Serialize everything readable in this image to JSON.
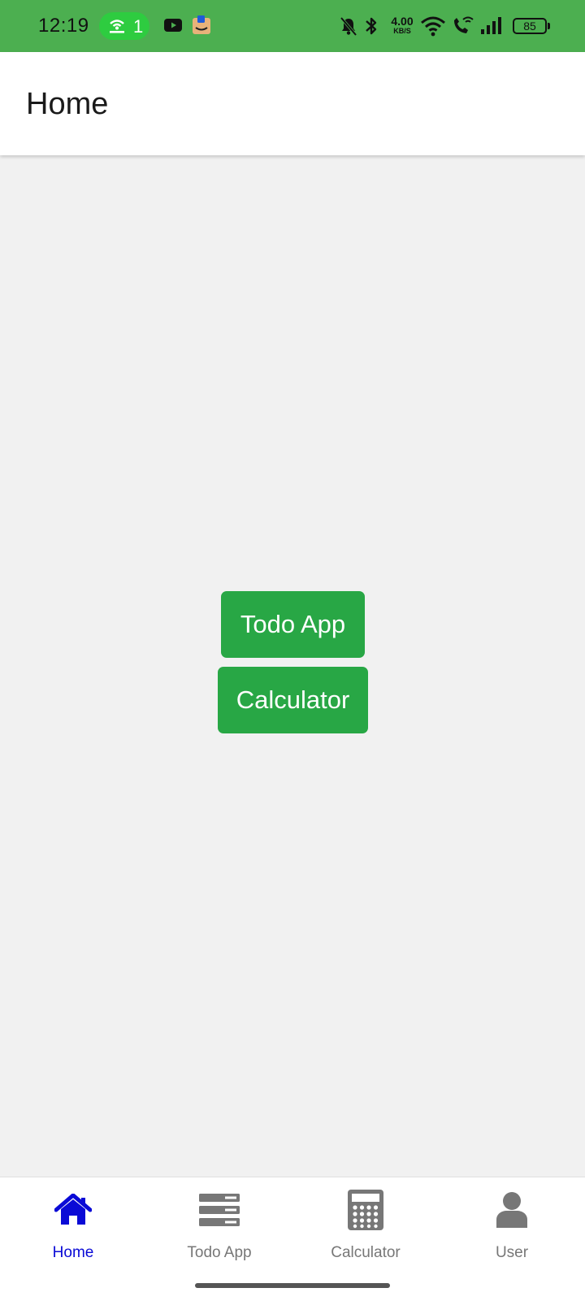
{
  "status_bar": {
    "time": "12:19",
    "hotspot_count": "1",
    "net_speed_value": "4.00",
    "net_speed_unit": "KB/S",
    "battery": "85",
    "icons": [
      "hotspot-icon",
      "youtube-icon",
      "amazon-icon",
      "mute-bell-icon",
      "bluetooth-icon",
      "wifi-icon",
      "wifi-calling-icon",
      "signal-icon",
      "battery-icon"
    ]
  },
  "app_bar": {
    "title": "Home"
  },
  "main": {
    "buttons": [
      {
        "label": "Todo App"
      },
      {
        "label": "Calculator"
      }
    ]
  },
  "bottom_nav": {
    "items": [
      {
        "label": "Home",
        "icon": "home-icon",
        "active": true
      },
      {
        "label": "Todo App",
        "icon": "list-icon",
        "active": false
      },
      {
        "label": "Calculator",
        "icon": "calculator-icon",
        "active": false
      },
      {
        "label": "User",
        "icon": "user-icon",
        "active": false
      }
    ]
  },
  "colors": {
    "status_bar": "#4caf50",
    "button": "#28a745",
    "nav_active": "#0a0ad6",
    "nav_inactive": "#777777",
    "background": "#f1f1f1"
  }
}
